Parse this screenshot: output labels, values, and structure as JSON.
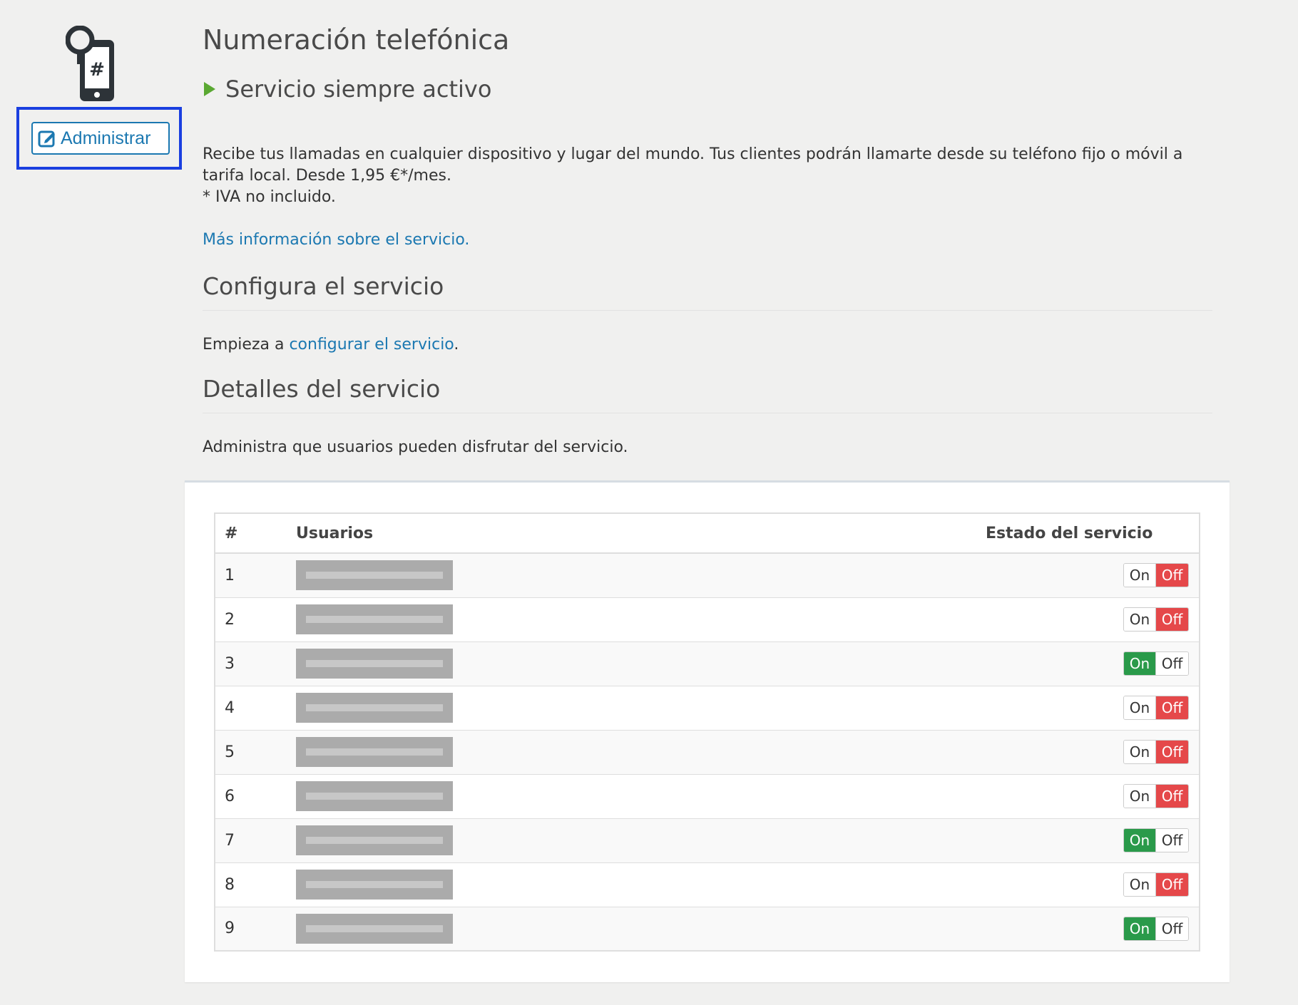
{
  "sidebar": {
    "service_icon": "phone-hash-icon",
    "admin_button_icon": "edit-icon",
    "admin_button_label": "Administrar"
  },
  "header": {
    "title": "Numeración telefónica",
    "status_icon": "play-icon",
    "status_text": "Servicio siempre activo"
  },
  "description": {
    "line1": "Recibe tus llamadas en cualquier dispositivo y lugar del mundo. Tus clientes podrán llamarte desde su teléfono fijo o móvil a tarifa local. Desde 1,95 €*/mes.",
    "line2": "* IVA no incluido.",
    "info_link": "Más información sobre el servicio."
  },
  "config": {
    "title": "Configura el servicio",
    "text_prefix": "Empieza a ",
    "link": "configurar el servicio",
    "text_suffix": "."
  },
  "details": {
    "title": "Detalles del servicio",
    "text": "Administra que usuarios pueden disfrutar del servicio."
  },
  "table": {
    "headers": {
      "num": "#",
      "users": "Usuarios",
      "state": "Estado del servicio"
    },
    "on_label": "On",
    "off_label": "Off",
    "rows": [
      {
        "num": "1",
        "state": "off"
      },
      {
        "num": "2",
        "state": "off"
      },
      {
        "num": "3",
        "state": "on"
      },
      {
        "num": "4",
        "state": "off"
      },
      {
        "num": "5",
        "state": "off"
      },
      {
        "num": "6",
        "state": "off"
      },
      {
        "num": "7",
        "state": "on"
      },
      {
        "num": "8",
        "state": "off"
      },
      {
        "num": "9",
        "state": "on"
      }
    ]
  },
  "colors": {
    "accent_link": "#1b78b1",
    "highlight_border": "#1a3fe0",
    "toggle_on": "#2a9a4a",
    "toggle_off": "#e5484a",
    "status_play": "#5aa832"
  }
}
